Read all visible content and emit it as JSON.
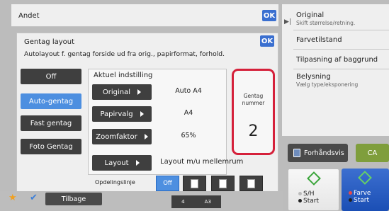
{
  "header": {
    "title": "Andet",
    "ok_label": "OK"
  },
  "dialog": {
    "title": "Gentag layout",
    "description": "Autolayout f. gentag forside ud fra orig., papirformat, forhold.",
    "ok_label": "OK"
  },
  "modes": [
    {
      "label": "Off",
      "active": false
    },
    {
      "label": "Auto-gentag",
      "active": true
    },
    {
      "label": "Fast gentag",
      "active": false
    },
    {
      "label": "Foto Gentag",
      "active": false
    }
  ],
  "current": {
    "title": "Aktuel indstilling",
    "rows": [
      {
        "button": "Original",
        "value": "Auto A4"
      },
      {
        "button": "Papirvalg",
        "value": "A4"
      },
      {
        "button": "Zoomfaktor",
        "value": "65%"
      }
    ]
  },
  "repeat": {
    "label_line1": "Gentag",
    "label_line2": "nummer",
    "value": "2"
  },
  "layout": {
    "button": "Layout",
    "value": "Layout m/u mellemrum"
  },
  "separator": {
    "label": "Opdelingslinje",
    "off_label": "Off"
  },
  "side_panel": {
    "items": [
      {
        "label": "Original",
        "sub": "Skift størrelse/retning."
      },
      {
        "label": "Farvetilstand",
        "sub": ""
      },
      {
        "label": "Tilpasning af baggrund",
        "sub": ""
      },
      {
        "label": "Belysning",
        "sub": "Vælg type/eksponering"
      }
    ]
  },
  "actions": {
    "preview": "Forhåndsvis",
    "ca": "CA",
    "start_bw_line1": "S/H",
    "start_bw_line2": "Start",
    "start_color_line1": "Farve",
    "start_color_line2": "Start"
  },
  "bottom": {
    "back": "Tilbage",
    "paper_count": "4",
    "paper_size": "A3"
  },
  "colors": {
    "accent": "#4d8fe0",
    "highlight": "#d5203a",
    "dark_button": "#3f3f3f"
  }
}
